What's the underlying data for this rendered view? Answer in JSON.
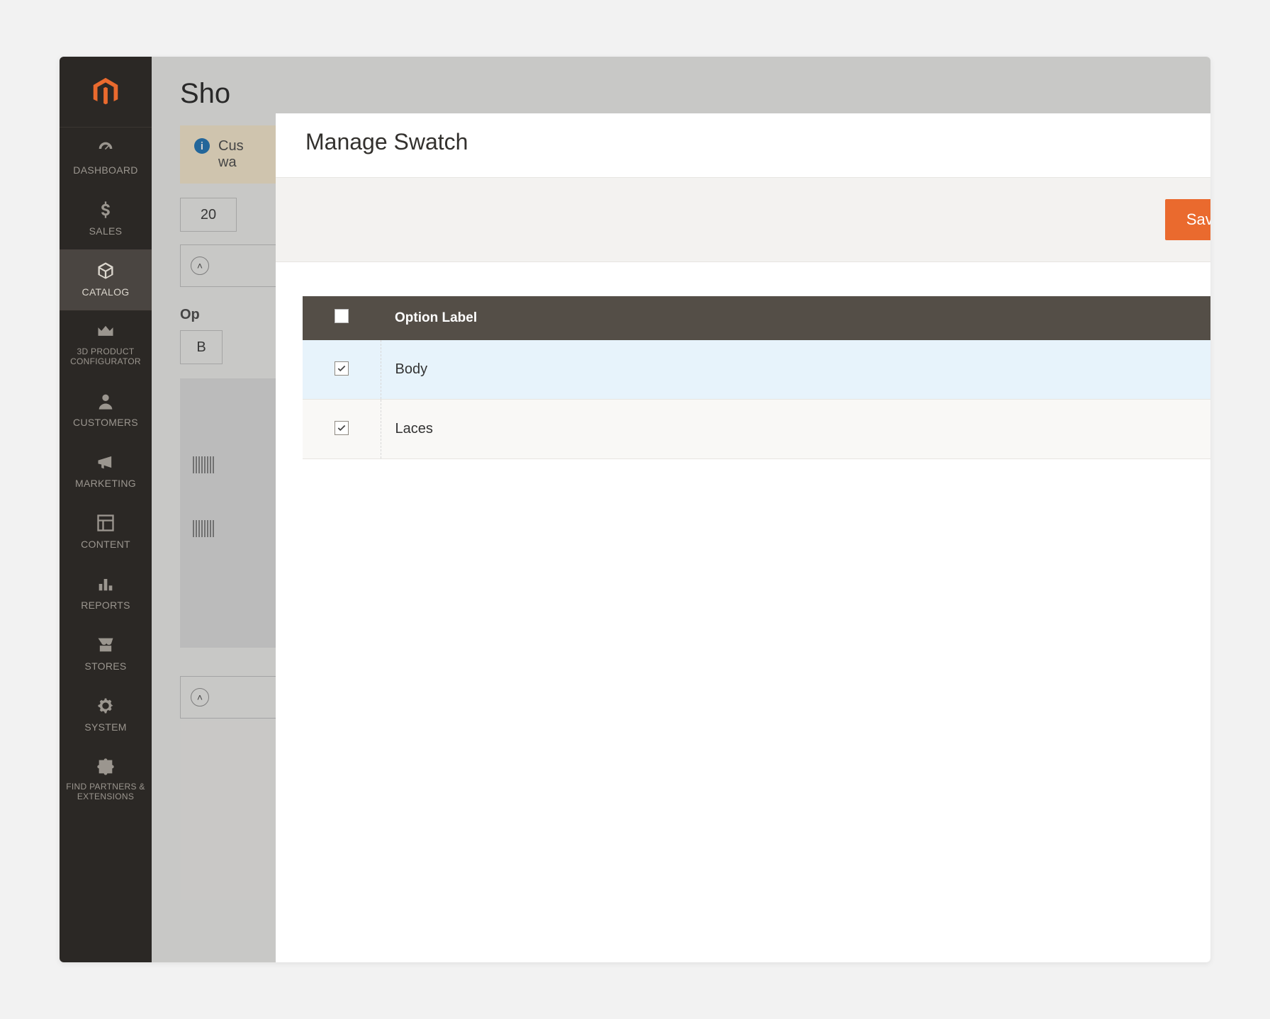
{
  "sidebar": {
    "items": [
      {
        "label": "DASHBOARD"
      },
      {
        "label": "SALES"
      },
      {
        "label": "CATALOG"
      },
      {
        "label": "3D PRODUCT CONFIGURATOR"
      },
      {
        "label": "CUSTOMERS"
      },
      {
        "label": "MARKETING"
      },
      {
        "label": "CONTENT"
      },
      {
        "label": "REPORTS"
      },
      {
        "label": "STORES"
      },
      {
        "label": "SYSTEM"
      },
      {
        "label": "FIND PARTNERS & EXTENSIONS"
      }
    ]
  },
  "page": {
    "title_fragment": "Sho",
    "notice_line1": "Cus",
    "notice_line2": "wa",
    "select_value": "20",
    "section_label": "Op",
    "field_value": "B"
  },
  "modal": {
    "title": "Manage Swatch",
    "save_label": "Save",
    "col_option_label": "Option Label",
    "header_checked": false,
    "rows": [
      {
        "label": "Body",
        "checked": true,
        "selected": true
      },
      {
        "label": "Laces",
        "checked": true,
        "selected": false
      }
    ]
  }
}
